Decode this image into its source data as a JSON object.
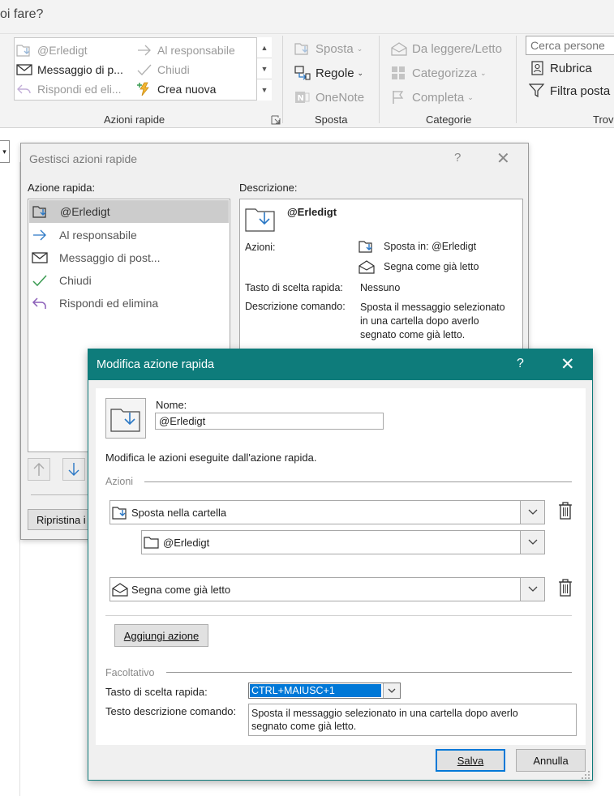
{
  "ribbon": {
    "search_prompt": "oi fare?",
    "quick_steps": {
      "items": [
        {
          "label": "@Erledigt",
          "icon": "folder-move-icon",
          "enabled": false
        },
        {
          "label": "Al responsabile",
          "icon": "arrow-right-icon",
          "enabled": false
        },
        {
          "label": "Messaggio di p...",
          "icon": "envelope-icon",
          "enabled": true
        },
        {
          "label": "Chiudi",
          "icon": "checkmark-icon",
          "enabled": false
        },
        {
          "label": "Rispondi ed eli...",
          "icon": "reply-delete-icon",
          "enabled": false
        },
        {
          "label": "Crea nuova",
          "icon": "lightning-new-icon",
          "enabled": true
        }
      ],
      "group_label": "Azioni rapide"
    },
    "move_group": {
      "sposta": "Sposta",
      "regole": "Regole",
      "onenote": "OneNote",
      "group_label": "Sposta"
    },
    "tags_group": {
      "read_unread": "Da leggere/Letto",
      "categorize": "Categorizza",
      "followup": "Completa",
      "group_label": "Categorie"
    },
    "find_group": {
      "people_placeholder": "Cerca persone",
      "address_book": "Rubrica",
      "filter_email": "Filtra posta e",
      "group_label": "Trova"
    }
  },
  "manage_dialog": {
    "title": "Gestisci azioni rapide",
    "help": "?",
    "close": "✕",
    "list_label": "Azione rapida:",
    "items": [
      {
        "label": "@Erledigt",
        "icon": "folder-move-icon",
        "selected": true
      },
      {
        "label": "Al responsabile",
        "icon": "arrow-right-icon",
        "selected": false
      },
      {
        "label": "Messaggio di post...",
        "icon": "envelope-icon",
        "selected": false
      },
      {
        "label": "Chiudi",
        "icon": "checkmark-icon",
        "selected": false
      },
      {
        "label": "Rispondi ed elimina",
        "icon": "reply-icon",
        "selected": false
      }
    ],
    "description_label": "Descrizione:",
    "description": {
      "name": "@Erledigt",
      "actions_label": "Azioni:",
      "action1": "Sposta in: @Erledigt",
      "action2": "Segna come già letto",
      "shortcut_label": "Tasto di scelta rapida:",
      "shortcut_value": "Nessuno",
      "tooltip_label": "Descrizione comando:",
      "tooltip_line1": "Sposta il messaggio selezionato",
      "tooltip_line2": "in una cartella dopo averlo",
      "tooltip_line3": "segnato come già letto."
    },
    "reset_button": "Ripristina i"
  },
  "edit_dialog": {
    "title": "Modifica azione rapida",
    "help": "?",
    "close": "✕",
    "name_label": "Nome:",
    "name_value": "@Erledigt",
    "instructions": "Modifica le azioni eseguite dall'azione rapida.",
    "actions_section": "Azioni",
    "action1": "Sposta nella cartella",
    "action1_folder": "@Erledigt",
    "action2": "Segna come già letto",
    "add_action": "Aggiungi azione",
    "optional_section": "Facoltativo",
    "shortcut_label": "Tasto di scelta rapida:",
    "shortcut_value": "CTRL+MAIUSC+1",
    "tooltip_label": "Testo descrizione comando:",
    "tooltip_line1": "Sposta il messaggio selezionato in una cartella dopo averlo",
    "tooltip_line2": "segnato come già letto.",
    "save": "Salva",
    "cancel": "Annulla"
  },
  "colors": {
    "accent_teal": "#0e7c7b",
    "selection_blue": "#0078d7",
    "icon_blue": "#2b78c5",
    "check_green": "#3a9b52",
    "reply_purple": "#8b5fb8"
  }
}
